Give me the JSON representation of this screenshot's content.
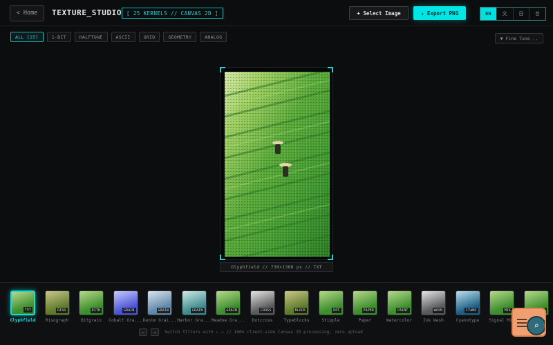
{
  "header": {
    "home_label": "< Home",
    "app_title": "TEXTURE_STUDIO",
    "badge": "[ 25 KERNELS // CANVAS 2D ]",
    "select_label": "+ Select Image",
    "export_label": "↓ Export PNG",
    "languages": [
      "EN",
      "文",
      "日",
      "한"
    ],
    "active_language": "EN"
  },
  "filters": {
    "chips": [
      "ALL [25]",
      "1-BIT",
      "HALFTONE",
      "ASCII",
      "GRID",
      "GEOMETRY",
      "ANALOG"
    ],
    "active": "ALL [25]",
    "finetune_label": "▼ Fine Tune .."
  },
  "canvas": {
    "caption": "Glyphfield // 736×1368 px // TXT"
  },
  "strip": {
    "thumbnails": [
      {
        "label": "Glyphfield",
        "tag": "TXT",
        "selected": true,
        "tone": "green"
      },
      {
        "label": "Risograph",
        "tag": "RISO",
        "tone": "olive"
      },
      {
        "label": "Bitgrain",
        "tag": "DITH",
        "tone": "green"
      },
      {
        "label": "Cobalt Gra...",
        "tag": "GRAIN",
        "tone": "blue"
      },
      {
        "label": "Denim Grai...",
        "tag": "GRAIN",
        "tone": "denim"
      },
      {
        "label": "Harbor Gra...",
        "tag": "GRAIN",
        "tone": "teal"
      },
      {
        "label": "Meadow Gra...",
        "tag": "GRAIN",
        "tone": "green"
      },
      {
        "label": "Dotcross",
        "tag": "CROSS",
        "tone": "gray"
      },
      {
        "label": "Typeblocks",
        "tag": "BLOCK",
        "tone": "olive"
      },
      {
        "label": "Stipple",
        "tag": "DOT",
        "tone": "green"
      },
      {
        "label": "Paper",
        "tag": "PAPER",
        "tone": "green"
      },
      {
        "label": "Watercolor",
        "tag": "PAINT",
        "tone": "green"
      },
      {
        "label": "Ink Wash",
        "tag": "WASH",
        "tone": "gray"
      },
      {
        "label": "Cyanotype",
        "tag": "CYANO",
        "tone": "cyan"
      },
      {
        "label": "Signal Mix",
        "tag": "MIX",
        "tone": "green"
      },
      {
        "label": "Pixelate",
        "tag": "PIXEL",
        "tone": "green"
      }
    ],
    "hint_keys": [
      "←",
      "→"
    ],
    "hint_text": "Switch filters with ← →  // 100% client-side Canvas 2D processing, zero upload"
  },
  "colors": {
    "accent": "#00e6e6",
    "background": "#0c0d0e"
  }
}
